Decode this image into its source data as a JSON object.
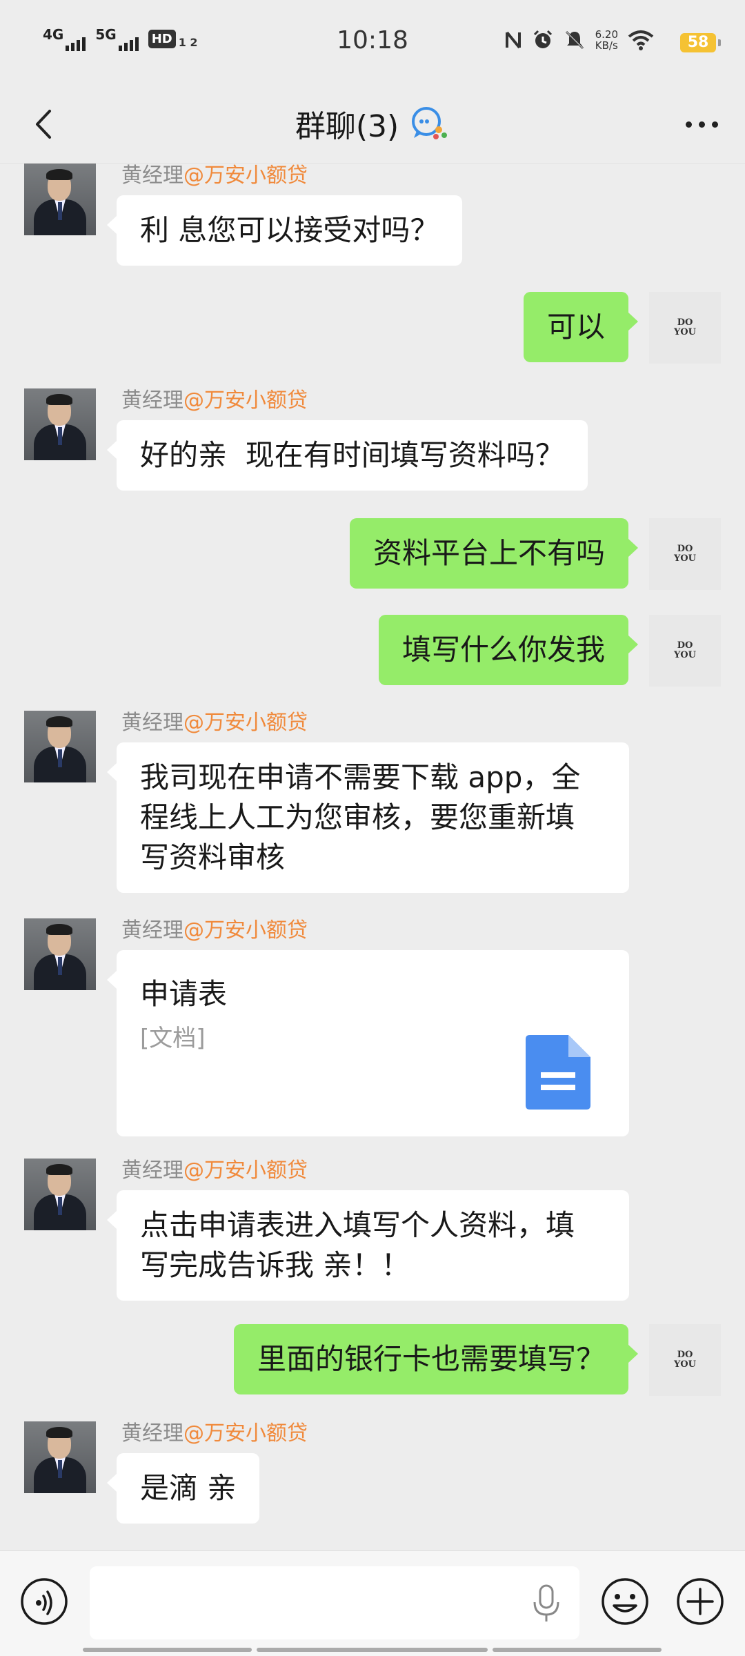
{
  "status_bar": {
    "net1": "4G",
    "net2": "5G",
    "hd": "HD",
    "hd_sub": "1 2",
    "time": "10:18",
    "speed_value": "6.20",
    "speed_unit": "KB/s",
    "battery": "58"
  },
  "header": {
    "title": "群聊(3)"
  },
  "messages": [
    {
      "from": "黄经理",
      "org": "@万安小额贷",
      "text": "利 息您可以接受对吗？"
    },
    {
      "from": "me",
      "text": "可以"
    },
    {
      "from": "黄经理",
      "org": "@万安小额贷",
      "text": "好的亲  现在有时间填写资料吗？"
    },
    {
      "from": "me",
      "text": "资料平台上不有吗"
    },
    {
      "from": "me",
      "text": "填写什么你发我"
    },
    {
      "from": "黄经理",
      "org": "@万安小额贷",
      "lines": [
        "我司现在申请不需要下载 app，全",
        "程线上人工为您审核，要您重新填",
        "写资料审核"
      ]
    },
    {
      "from": "黄经理",
      "org": "@万安小额贷",
      "doc_title": "申请表",
      "doc_type": "[文档]"
    },
    {
      "from": "黄经理",
      "org": "@万安小额贷",
      "lines": [
        "点击申请表进入填写个人资料，填",
        "写完成告诉我 亲！！"
      ]
    },
    {
      "from": "me",
      "text": "里面的银行卡也需要填写？"
    },
    {
      "from": "黄经理",
      "org": "@万安小额贷",
      "text": "是滴 亲"
    }
  ],
  "my_avatar_text": [
    "DO",
    "YOU"
  ],
  "input_bar": {
    "placeholder": ""
  },
  "colors": {
    "outgoing_bubble": "#95ec69",
    "incoming_bubble": "#ffffff",
    "org_name": "#f08a3c",
    "background": "#ededed"
  },
  "icons": [
    "back-icon",
    "group-chat-icon",
    "more-icon",
    "voice-icon",
    "mic-icon",
    "emoji-icon",
    "plus-icon",
    "document-icon"
  ]
}
